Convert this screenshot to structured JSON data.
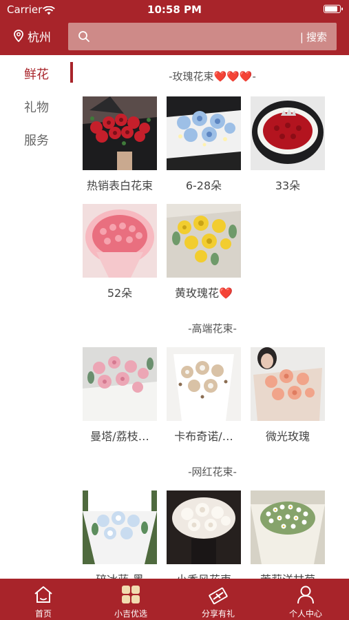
{
  "status_bar": {
    "carrier": "Carrier",
    "time": "10:58 PM",
    "battery_level": 0.9
  },
  "header": {
    "city": "杭州",
    "search_button": "搜索"
  },
  "sidebar": {
    "items": [
      {
        "label": "鲜花",
        "active": true
      },
      {
        "label": "礼物",
        "active": false
      },
      {
        "label": "服务",
        "active": false
      }
    ]
  },
  "sections": [
    {
      "title": "-玫瑰花束❤️❤️❤️-",
      "products": [
        {
          "name": "热销表白花束",
          "image": "red-rose-bouquet"
        },
        {
          "name": "6-28朵",
          "image": "blue-rose-bouquet"
        },
        {
          "name": "33朵",
          "image": "red-rose-crown-bouquet"
        },
        {
          "name": "52朵",
          "image": "pink-rose-bouquet"
        },
        {
          "name": "黄玫瑰花❤️",
          "image": "yellow-rose-bouquet"
        }
      ]
    },
    {
      "title": "-高端花束-",
      "products": [
        {
          "name": "曼塔/荔枝…",
          "image": "pink-garden-rose-bouquet"
        },
        {
          "name": "卡布奇诺/…",
          "image": "cappuccino-rose-bouquet"
        },
        {
          "name": "微光玫瑰",
          "image": "peach-rose-bouquet"
        }
      ]
    },
    {
      "title": "-网红花束-",
      "products": [
        {
          "name": "碎冰蓝-黑",
          "image": "blue-white-rose-bouquet"
        },
        {
          "name": "小香风花束",
          "image": "white-rose-bouquet"
        },
        {
          "name": "茉莉洋甘菊",
          "image": "chamomile-bouquet"
        }
      ]
    }
  ],
  "tabbar": {
    "tabs": [
      {
        "label": "首页",
        "icon": "home-icon"
      },
      {
        "label": "小吉优选",
        "icon": "grid-icon"
      },
      {
        "label": "分享有礼",
        "icon": "gift-icon"
      },
      {
        "label": "个人中心",
        "icon": "user-icon"
      }
    ]
  },
  "colors": {
    "brand": "#a8242a",
    "search_bg": "#ce8a88",
    "accent_text": "#a8242a"
  }
}
